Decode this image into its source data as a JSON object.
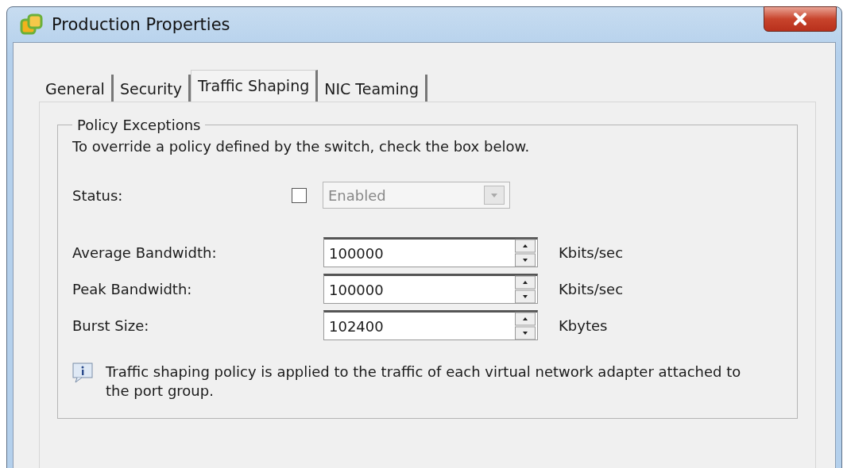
{
  "window": {
    "title": "Production Properties"
  },
  "tabs": [
    {
      "label": "General",
      "selected": false
    },
    {
      "label": "Security",
      "selected": false
    },
    {
      "label": "Traffic Shaping",
      "selected": true
    },
    {
      "label": "NIC Teaming",
      "selected": false
    }
  ],
  "group": {
    "title": "Policy Exceptions",
    "instruction": "To override a policy defined by the switch, check the box below.",
    "status": {
      "label": "Status:",
      "checked": false,
      "value": "Enabled",
      "disabled": true
    },
    "fields": [
      {
        "label": "Average Bandwidth:",
        "value": "100000",
        "unit": "Kbits/sec"
      },
      {
        "label": "Peak Bandwidth:",
        "value": "100000",
        "unit": "Kbits/sec"
      },
      {
        "label": "Burst Size:",
        "value": "102400",
        "unit": "Kbytes"
      }
    ],
    "note": "Traffic shaping policy is applied to the traffic of each virtual network adapter attached to the port group."
  }
}
